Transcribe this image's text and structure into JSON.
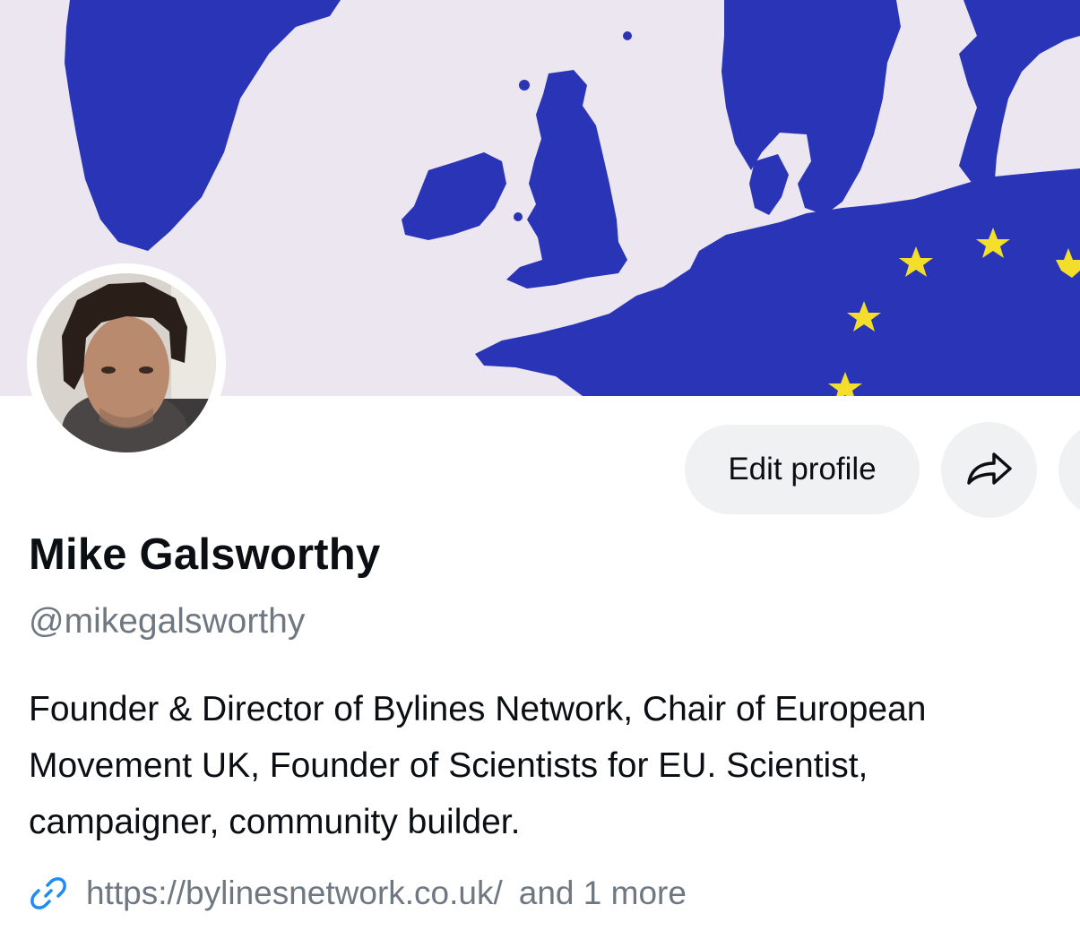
{
  "profile": {
    "display_name": "Mike Galsworthy",
    "handle": "@mikegalsworthy",
    "bio_lines": [
      "Founder & Director of Bylines Network, Chair of European",
      "Movement UK, Founder of Scientists for EU. Scientist,",
      "campaigner, community builder."
    ],
    "link_url": "https://bylinesnetwork.co.uk/",
    "link_more": "and 1 more"
  },
  "actions": {
    "edit_profile_label": "Edit profile"
  },
  "icons": {
    "share": "share-arrow-icon",
    "link": "link-icon",
    "more": "more-options-icon"
  },
  "colors": {
    "map_land": "#2a34b7",
    "map_sea": "#ebe6ef",
    "stars": "#f3de2c",
    "button_bg": "#f0f1f2",
    "link_icon": "#1d8cf8",
    "muted_text": "#6f7880"
  }
}
